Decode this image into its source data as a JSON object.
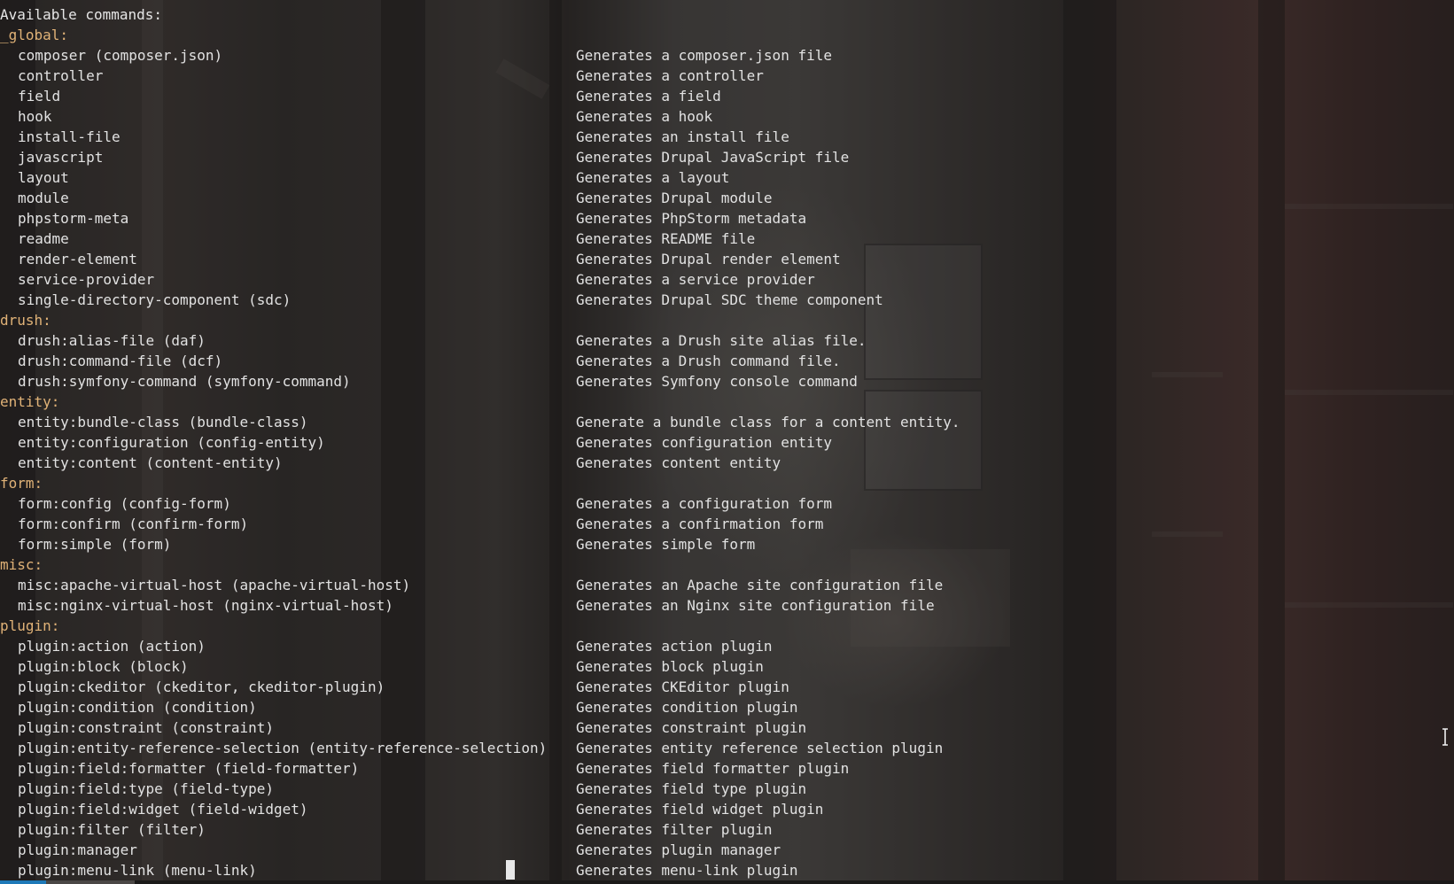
{
  "terminal": {
    "header": "Available commands:",
    "groups": [
      {
        "label": "_global:",
        "commands": [
          {
            "name": "composer (composer.json)",
            "description": "Generates a composer.json file"
          },
          {
            "name": "controller",
            "description": "Generates a controller"
          },
          {
            "name": "field",
            "description": "Generates a field"
          },
          {
            "name": "hook",
            "description": "Generates a hook"
          },
          {
            "name": "install-file",
            "description": "Generates an install file"
          },
          {
            "name": "javascript",
            "description": "Generates Drupal JavaScript file"
          },
          {
            "name": "layout",
            "description": "Generates a layout"
          },
          {
            "name": "module",
            "description": "Generates Drupal module"
          },
          {
            "name": "phpstorm-meta",
            "description": "Generates PhpStorm metadata"
          },
          {
            "name": "readme",
            "description": "Generates README file"
          },
          {
            "name": "render-element",
            "description": "Generates Drupal render element"
          },
          {
            "name": "service-provider",
            "description": "Generates a service provider"
          },
          {
            "name": "single-directory-component (sdc)",
            "description": "Generates Drupal SDC theme component"
          }
        ]
      },
      {
        "label": "drush:",
        "commands": [
          {
            "name": "drush:alias-file (daf)",
            "description": "Generates a Drush site alias file."
          },
          {
            "name": "drush:command-file (dcf)",
            "description": "Generates a Drush command file."
          },
          {
            "name": "drush:symfony-command (symfony-command)",
            "description": "Generates Symfony console command"
          }
        ]
      },
      {
        "label": "entity:",
        "commands": [
          {
            "name": "entity:bundle-class (bundle-class)",
            "description": "Generate a bundle class for a content entity."
          },
          {
            "name": "entity:configuration (config-entity)",
            "description": "Generates configuration entity"
          },
          {
            "name": "entity:content (content-entity)",
            "description": "Generates content entity"
          }
        ]
      },
      {
        "label": "form:",
        "commands": [
          {
            "name": "form:config (config-form)",
            "description": "Generates a configuration form"
          },
          {
            "name": "form:confirm (confirm-form)",
            "description": "Generates a confirmation form"
          },
          {
            "name": "form:simple (form)",
            "description": "Generates simple form"
          }
        ]
      },
      {
        "label": "misc:",
        "commands": [
          {
            "name": "misc:apache-virtual-host (apache-virtual-host)",
            "description": "Generates an Apache site configuration file"
          },
          {
            "name": "misc:nginx-virtual-host (nginx-virtual-host)",
            "description": "Generates an Nginx site configuration file"
          }
        ]
      },
      {
        "label": "plugin:",
        "commands": [
          {
            "name": "plugin:action (action)",
            "description": "Generates action plugin"
          },
          {
            "name": "plugin:block (block)",
            "description": "Generates block plugin"
          },
          {
            "name": "plugin:ckeditor (ckeditor, ckeditor-plugin)",
            "description": "Generates CKEditor plugin"
          },
          {
            "name": "plugin:condition (condition)",
            "description": "Generates condition plugin"
          },
          {
            "name": "plugin:constraint (constraint)",
            "description": "Generates constraint plugin"
          },
          {
            "name": "plugin:entity-reference-selection (entity-reference-selection)",
            "description": "Generates entity reference selection plugin"
          },
          {
            "name": "plugin:field:formatter (field-formatter)",
            "description": "Generates field formatter plugin"
          },
          {
            "name": "plugin:field:type (field-type)",
            "description": "Generates field type plugin"
          },
          {
            "name": "plugin:field:widget (field-widget)",
            "description": "Generates field widget plugin"
          },
          {
            "name": "plugin:filter (filter)",
            "description": "Generates filter plugin"
          },
          {
            "name": "plugin:manager",
            "description": "Generates plugin manager"
          },
          {
            "name": "plugin:menu-link (menu-link)",
            "description": "Generates menu-link plugin"
          }
        ]
      }
    ]
  },
  "colors": {
    "text": "#e2e2e2",
    "group_label": "#e0b277",
    "status_accent": "#1e79b8"
  },
  "icons": {
    "text_cursor": "i-beam-cursor-icon",
    "terminal_cursor": "block-cursor-icon"
  }
}
